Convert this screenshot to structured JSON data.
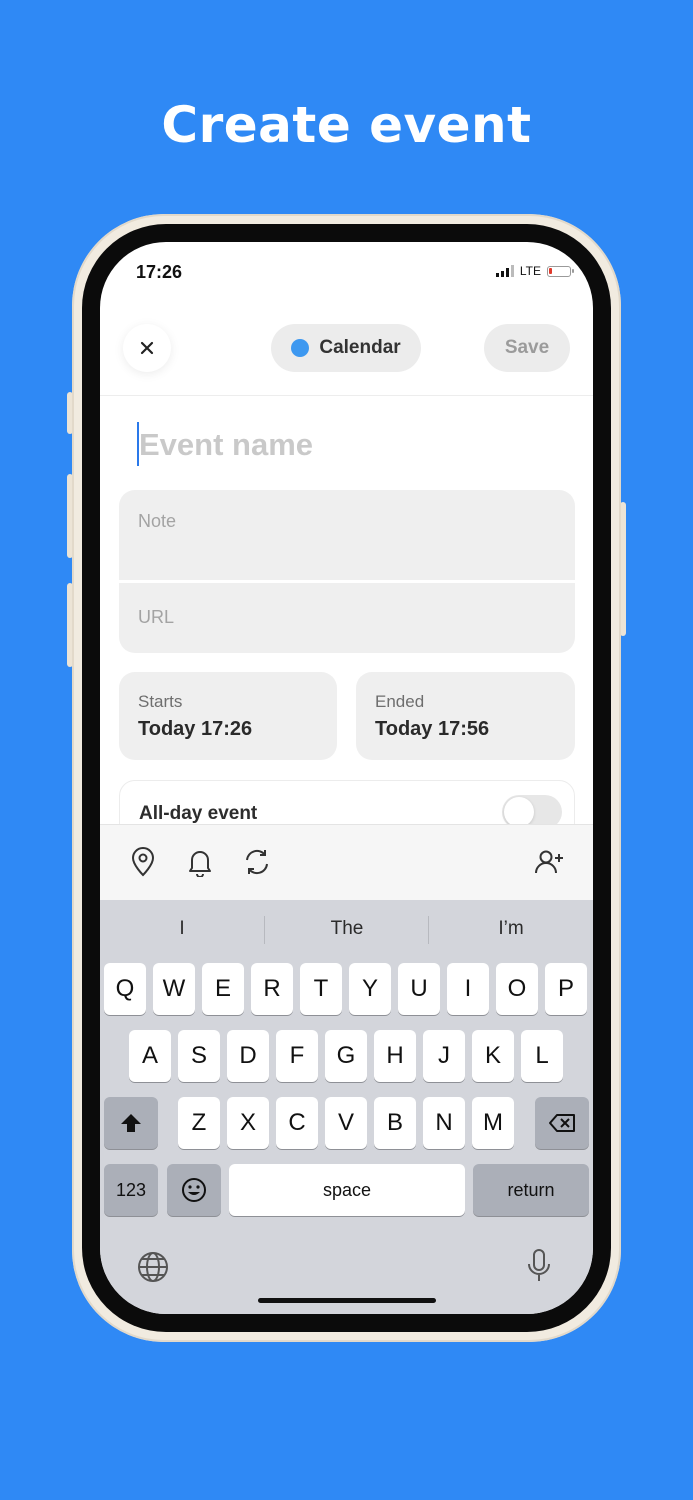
{
  "headline": "Create event",
  "status_bar": {
    "time": "17:26",
    "network": "LTE"
  },
  "header": {
    "calendar_label": "Calendar",
    "save_label": "Save"
  },
  "form": {
    "event_name_placeholder": "Event name",
    "note_placeholder": "Note",
    "url_placeholder": "URL",
    "starts": {
      "label": "Starts",
      "value": "Today 17:26"
    },
    "ends": {
      "label": "Ended",
      "value": "Today 17:56"
    },
    "all_day": {
      "label": "All-day event",
      "on": false
    }
  },
  "keyboard": {
    "suggestions": [
      "I",
      "The",
      "I’m"
    ],
    "row1": [
      "Q",
      "W",
      "E",
      "R",
      "T",
      "Y",
      "U",
      "I",
      "O",
      "P"
    ],
    "row2": [
      "A",
      "S",
      "D",
      "F",
      "G",
      "H",
      "J",
      "K",
      "L"
    ],
    "row3": [
      "Z",
      "X",
      "C",
      "V",
      "B",
      "N",
      "M"
    ],
    "numbers_key": "123",
    "space_key": "space",
    "return_key": "return"
  },
  "colors": {
    "background": "#2f89f5",
    "calendar_dot": "#3d98f0"
  }
}
